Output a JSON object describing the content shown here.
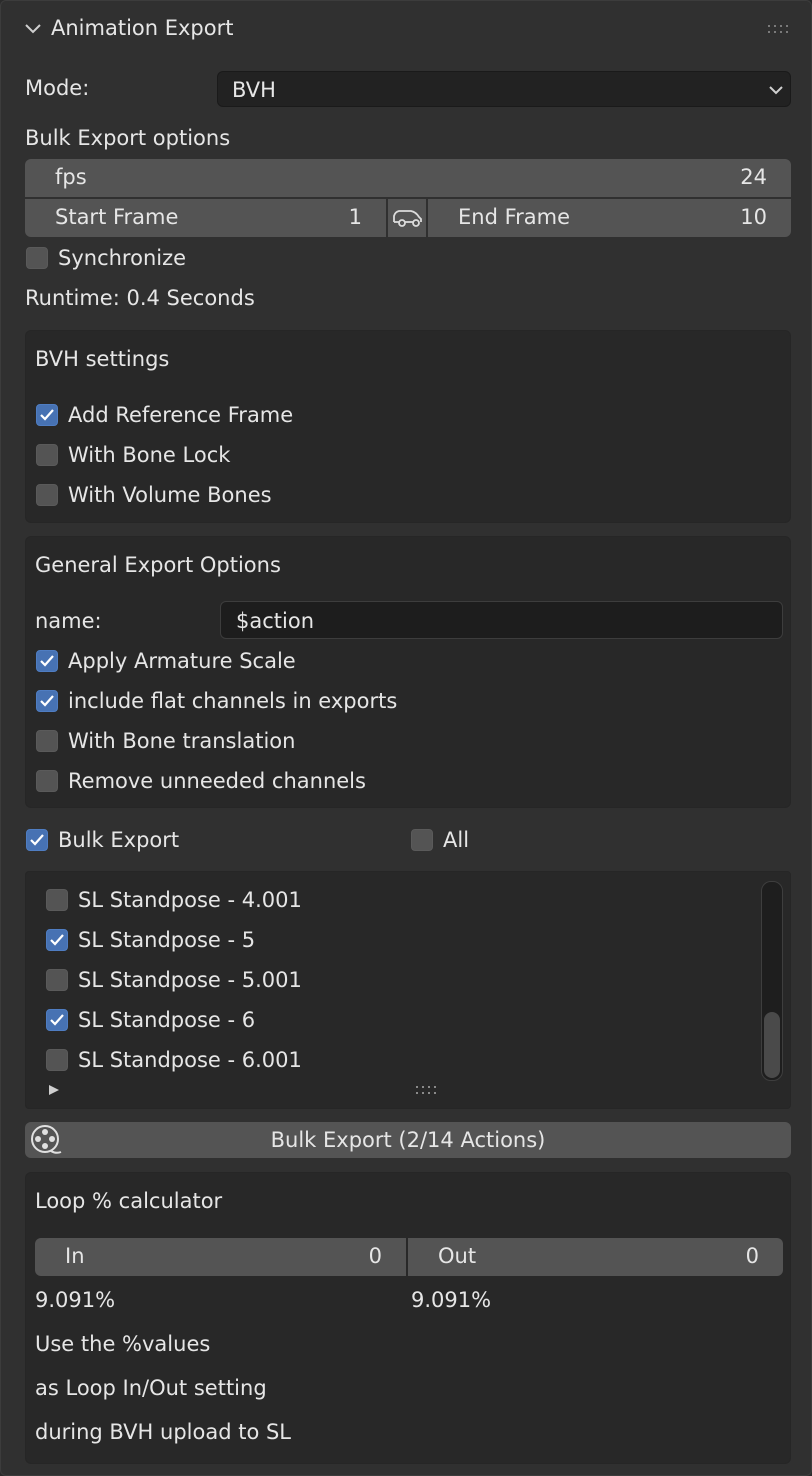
{
  "header": {
    "title": "Animation Export",
    "collapse_icon": "chevron-down-icon",
    "drag_icon": "grip-icon"
  },
  "mode": {
    "label": "Mode:",
    "value": "BVH"
  },
  "bulk_options": {
    "title": "Bulk Export options",
    "fps_label": "fps",
    "fps_value": "24",
    "start_label": "Start Frame",
    "start_value": "1",
    "end_label": "End Frame",
    "end_value": "10",
    "link_icon": "car-link-icon",
    "synchronize_label": "Synchronize",
    "synchronize_checked": false,
    "runtime": "Runtime: 0.4 Seconds"
  },
  "bvh_settings": {
    "title": "BVH settings",
    "options": [
      {
        "label": "Add Reference Frame",
        "checked": true
      },
      {
        "label": "With Bone Lock",
        "checked": false
      },
      {
        "label": "With Volume Bones",
        "checked": false
      }
    ]
  },
  "general_options": {
    "title": "General Export Options",
    "name_label": "name:",
    "name_value": "$action",
    "options": [
      {
        "label": "Apply Armature Scale",
        "checked": true
      },
      {
        "label": "include flat channels in exports",
        "checked": true
      },
      {
        "label": "With Bone translation",
        "checked": false
      },
      {
        "label": "Remove unneeded channels",
        "checked": false
      }
    ]
  },
  "bulk_export": {
    "label": "Bulk Export",
    "checked": true,
    "all_label": "All",
    "all_checked": false,
    "items": [
      {
        "label": "SL Standpose - 4.001",
        "checked": false
      },
      {
        "label": "SL Standpose - 5",
        "checked": true
      },
      {
        "label": "SL Standpose - 5.001",
        "checked": false
      },
      {
        "label": "SL Standpose - 6",
        "checked": true
      },
      {
        "label": "SL Standpose - 6.001",
        "checked": false
      }
    ],
    "button_label": "Bulk Export (2/14 Actions)",
    "button_icon": "film-reel-icon"
  },
  "loop_calc": {
    "title": "Loop % calculator",
    "in_label": "In",
    "in_value": "0",
    "out_label": "Out",
    "out_value": "0",
    "in_percent": "9.091%",
    "out_percent": "9.091%",
    "note_1": "Use the %values",
    "note_2": "as Loop In/Out setting",
    "note_3": "during BVH upload to SL"
  },
  "colors": {
    "accent": "#4772b3",
    "background": "#303030",
    "field": "#545454",
    "box": "#282828"
  }
}
